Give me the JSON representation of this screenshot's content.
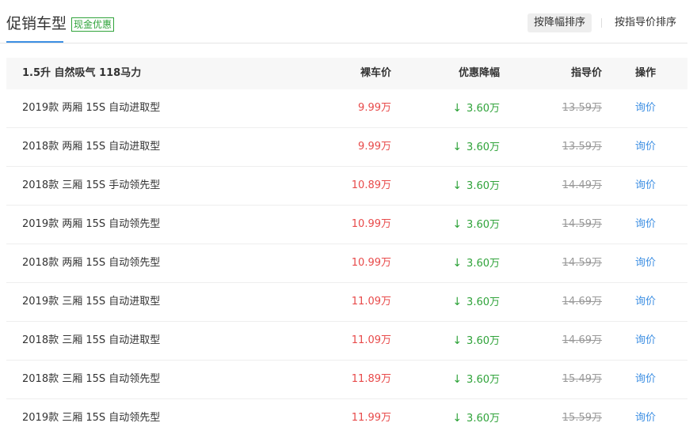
{
  "header": {
    "title": "促销车型",
    "badge": "现金优惠",
    "sort_options": [
      "按降幅排序",
      "按指导价排序"
    ]
  },
  "table": {
    "group_title": "1.5升 自然吸气 118马力",
    "columns": {
      "price": "裸车价",
      "discount": "优惠降幅",
      "guide": "指导价",
      "action": "操作"
    },
    "rows": [
      {
        "name": "2019款 两厢 15S 自动进取型",
        "price": "9.99万",
        "discount": "3.60万",
        "guide": "13.59万",
        "action": "询价"
      },
      {
        "name": "2018款 两厢 15S 自动进取型",
        "price": "9.99万",
        "discount": "3.60万",
        "guide": "13.59万",
        "action": "询价"
      },
      {
        "name": "2018款 三厢 15S 手动领先型",
        "price": "10.89万",
        "discount": "3.60万",
        "guide": "14.49万",
        "action": "询价"
      },
      {
        "name": "2019款 两厢 15S 自动领先型",
        "price": "10.99万",
        "discount": "3.60万",
        "guide": "14.59万",
        "action": "询价"
      },
      {
        "name": "2018款 两厢 15S 自动领先型",
        "price": "10.99万",
        "discount": "3.60万",
        "guide": "14.59万",
        "action": "询价"
      },
      {
        "name": "2019款 三厢 15S 自动进取型",
        "price": "11.09万",
        "discount": "3.60万",
        "guide": "14.69万",
        "action": "询价"
      },
      {
        "name": "2018款 三厢 15S 自动进取型",
        "price": "11.09万",
        "discount": "3.60万",
        "guide": "14.69万",
        "action": "询价"
      },
      {
        "name": "2018款 三厢 15S 自动领先型",
        "price": "11.89万",
        "discount": "3.60万",
        "guide": "15.49万",
        "action": "询价"
      },
      {
        "name": "2019款 三厢 15S 自动领先型",
        "price": "11.99万",
        "discount": "3.60万",
        "guide": "15.59万",
        "action": "询价"
      }
    ]
  },
  "colors": {
    "price": "#e84a4a",
    "discount": "#2fa33a",
    "link": "#3d8fe3",
    "badge": "#2fa33a"
  },
  "icons": {
    "discount_arrow": "arrow-down-icon"
  }
}
